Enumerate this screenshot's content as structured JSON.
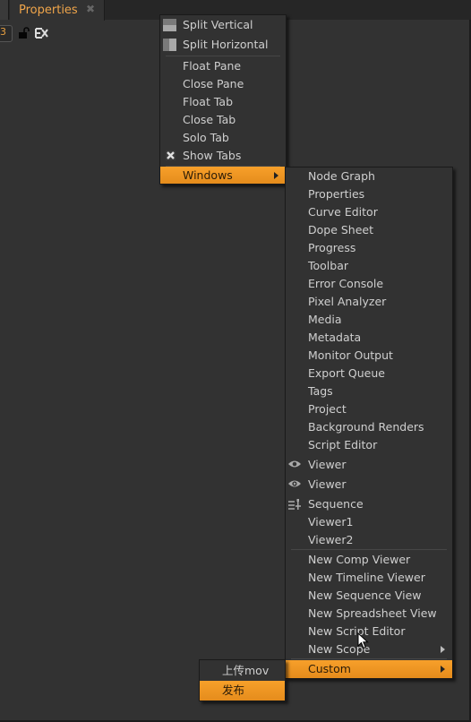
{
  "tabbar": {
    "active_tab": "Properties",
    "close_icon": "close-icon"
  },
  "toolbar": {
    "field_value": "3",
    "lock_icon": "unlock-icon",
    "clear_icon": "clear-panels-icon"
  },
  "context_menu": {
    "items": [
      {
        "label": "Split Vertical",
        "icon": "split-vertical-icon"
      },
      {
        "label": "Split Horizontal",
        "icon": "split-horizontal-icon"
      },
      {
        "label": "Float Pane"
      },
      {
        "label": "Close Pane"
      },
      {
        "label": "Float Tab"
      },
      {
        "label": "Close Tab"
      },
      {
        "label": "Solo Tab"
      },
      {
        "label": "Show Tabs",
        "checked": true,
        "icon": "checkbox-x-icon"
      },
      {
        "label": "Windows",
        "submenu": true,
        "highlighted": true
      }
    ]
  },
  "windows_menu": {
    "items": [
      {
        "label": "Node Graph"
      },
      {
        "label": "Properties"
      },
      {
        "label": "Curve Editor"
      },
      {
        "label": "Dope Sheet"
      },
      {
        "label": "Progress"
      },
      {
        "label": "Toolbar"
      },
      {
        "label": "Error Console"
      },
      {
        "label": "Pixel Analyzer"
      },
      {
        "label": "Media"
      },
      {
        "label": "Metadata"
      },
      {
        "label": "Monitor Output"
      },
      {
        "label": "Export Queue"
      },
      {
        "label": "Tags"
      },
      {
        "label": "Project"
      },
      {
        "label": "Background Renders"
      },
      {
        "label": "Script Editor"
      },
      {
        "label": "Viewer",
        "icon": "eye-icon"
      },
      {
        "label": "Viewer",
        "icon": "eye-play-icon"
      },
      {
        "label": "Sequence",
        "icon": "sequence-icon"
      },
      {
        "label": "Viewer1"
      },
      {
        "label": "Viewer2"
      },
      {
        "label": "New Comp Viewer"
      },
      {
        "label": "New Timeline Viewer"
      },
      {
        "label": "New Sequence View"
      },
      {
        "label": "New Spreadsheet View"
      },
      {
        "label": "New Script Editor"
      },
      {
        "label": "New Scope",
        "submenu": true
      },
      {
        "label": "Custom",
        "submenu": true,
        "highlighted": true
      }
    ]
  },
  "custom_menu": {
    "items": [
      {
        "label": "上传mov"
      },
      {
        "label": "发布",
        "highlighted": true
      }
    ]
  },
  "colors": {
    "accent": "#f7a02a",
    "background": "#323232",
    "tab_text": "#f0a54a"
  }
}
